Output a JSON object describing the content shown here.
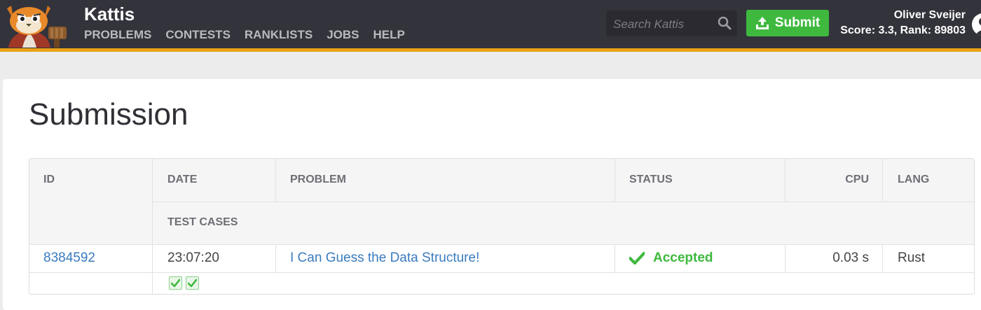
{
  "header": {
    "brand": "Kattis",
    "nav": [
      "PROBLEMS",
      "CONTESTS",
      "RANKLISTS",
      "JOBS",
      "HELP"
    ],
    "search": {
      "placeholder": "Search Kattis",
      "value": ""
    },
    "submit_label": "Submit",
    "user": {
      "name": "Oliver Sveijer",
      "score_text": "Score: 3.3, Rank: 89803"
    },
    "colors": {
      "bar": "#33333b",
      "accent": "#e8a317",
      "submit": "#3eb93e"
    }
  },
  "page": {
    "title": "Submission"
  },
  "table": {
    "headers": {
      "id": "ID",
      "date": "DATE",
      "problem": "PROBLEM",
      "status": "STATUS",
      "cpu": "CPU",
      "lang": "LANG",
      "test_cases": "TEST CASES"
    },
    "row": {
      "id": "8384592",
      "date": "23:07:20",
      "problem": "I Can Guess the Data Structure!",
      "status": "Accepted",
      "cpu": "0.03 s",
      "lang": "Rust"
    },
    "test_cases": [
      "passed",
      "passed"
    ]
  },
  "icons": {
    "logo": "kattis-cat-logo",
    "search": "search-icon",
    "submit": "upload-icon",
    "status": "check-icon",
    "test": "check-icon"
  }
}
